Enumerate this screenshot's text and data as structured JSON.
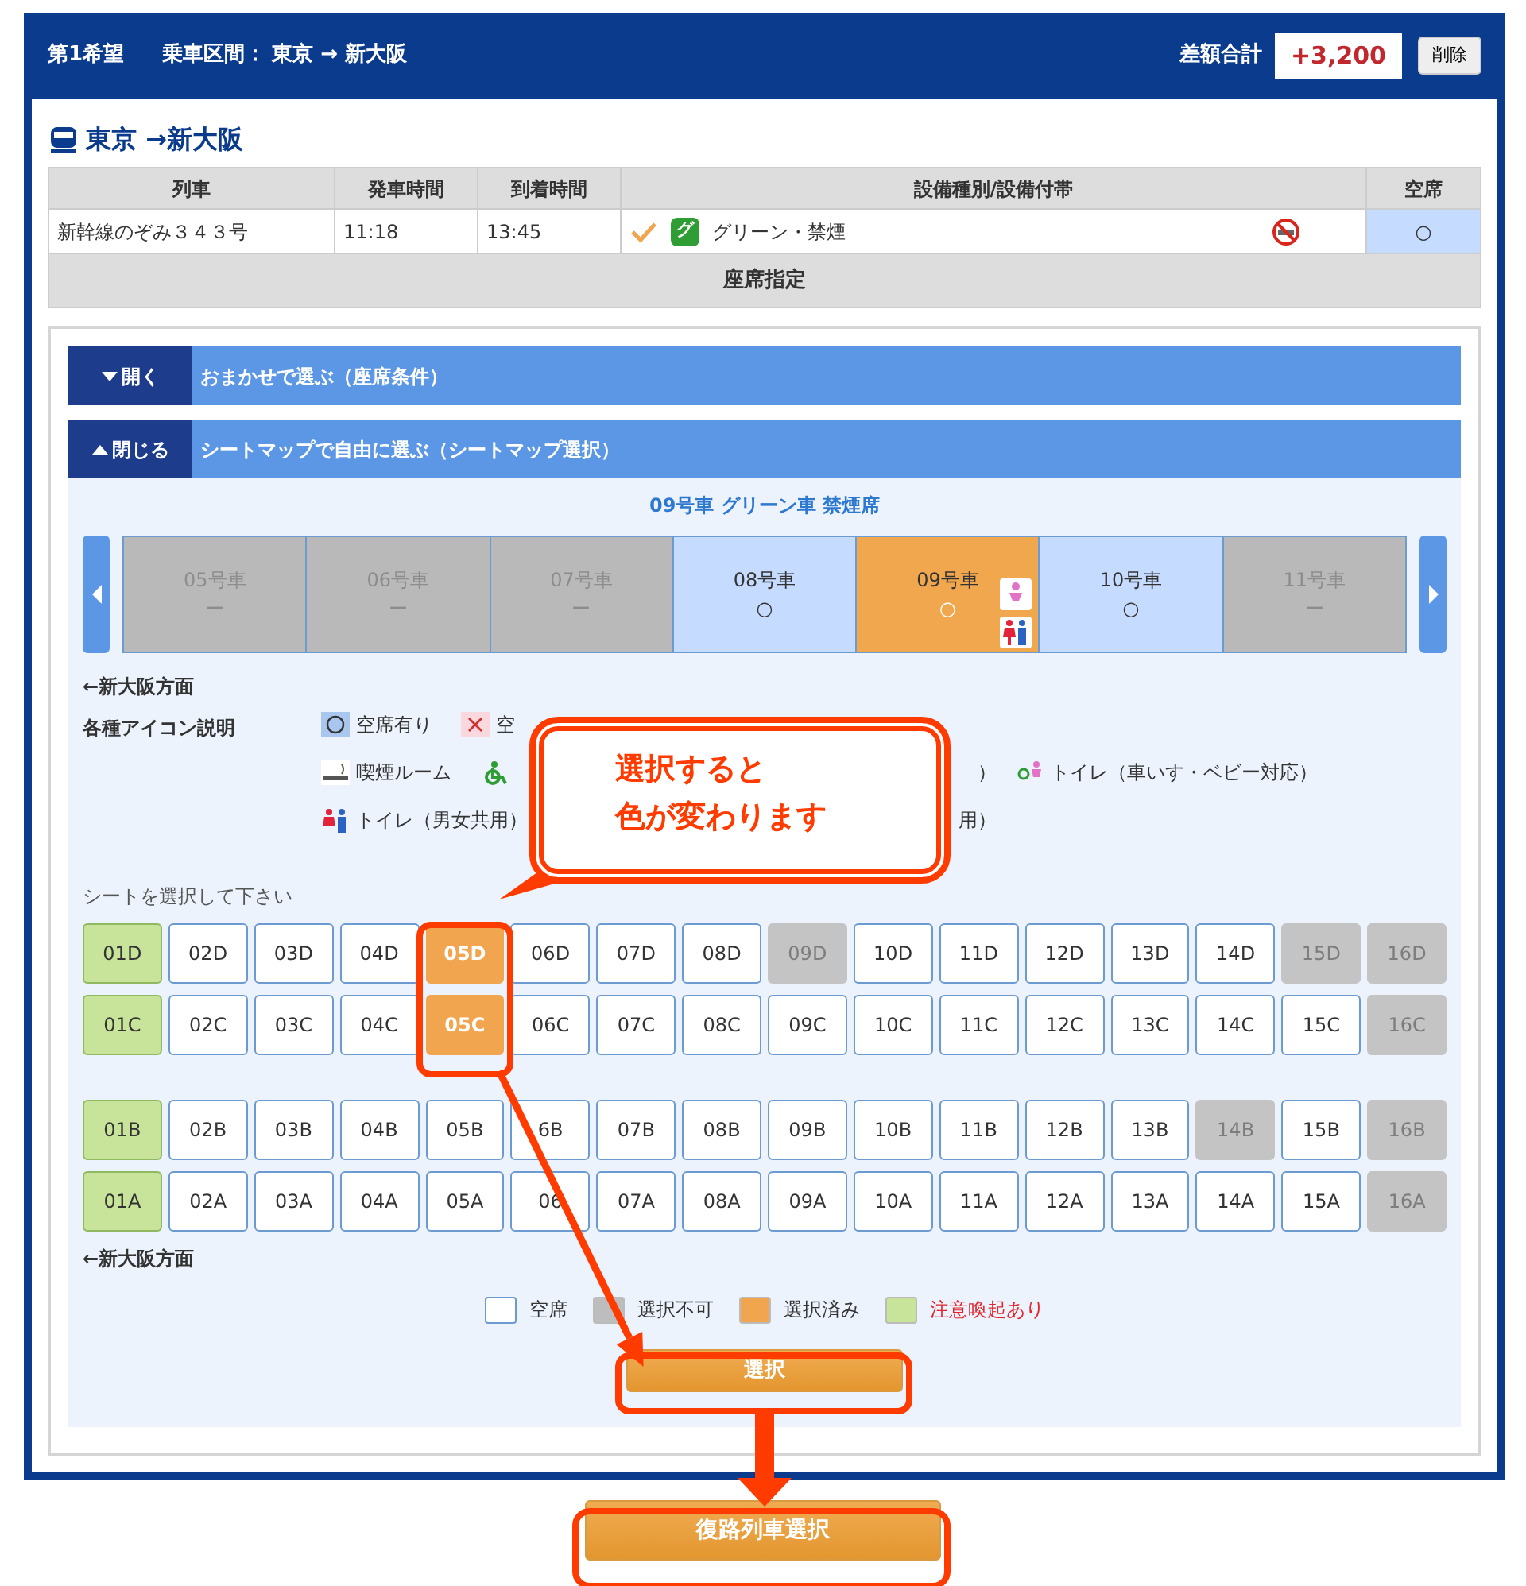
{
  "header": {
    "priority": "第1希望",
    "route_label": "乗車区間：",
    "route": "東京 → 新大阪",
    "total_label": "差額合計",
    "total": "+3,200",
    "delete_button": "削除"
  },
  "title": "東京 →新大阪",
  "train_table": {
    "columns": [
      "列車",
      "発車時間",
      "到着時間",
      "設備種別/設備付帯",
      "空席"
    ],
    "rows": [
      {
        "train": "新幹線のぞみ３４３号",
        "departure": "11:18",
        "arrival": "13:45",
        "checked": true,
        "car_badge": "グ",
        "facility": "グリーン・禁煙",
        "non_smoking": true,
        "vacancy": "○"
      }
    ],
    "footer": "座席指定"
  },
  "accordions": [
    {
      "toggle": "開く",
      "expanded": false,
      "title": "おまかせで選ぶ（座席条件）"
    },
    {
      "toggle": "閉じる",
      "expanded": true,
      "title": "シートマップで自由に選ぶ（シートマップ選択）"
    }
  ],
  "car_title": "09号車 グリーン車 禁煙席",
  "cars": [
    {
      "label": "05号車",
      "mark": "ー",
      "available": false,
      "selected": false,
      "toilets": false
    },
    {
      "label": "06号車",
      "mark": "ー",
      "available": false,
      "selected": false,
      "toilets": false
    },
    {
      "label": "07号車",
      "mark": "ー",
      "available": false,
      "selected": false,
      "toilets": false
    },
    {
      "label": "08号車",
      "mark": "○",
      "available": true,
      "selected": false,
      "toilets": false
    },
    {
      "label": "09号車",
      "mark": "○",
      "available": true,
      "selected": true,
      "toilets": true
    },
    {
      "label": "10号車",
      "mark": "○",
      "available": true,
      "selected": false,
      "toilets": false
    },
    {
      "label": "11号車",
      "mark": "ー",
      "available": false,
      "selected": false,
      "toilets": false
    }
  ],
  "direction_top": "←新大阪方面",
  "icon_legend_label": "各種アイコン説明",
  "icon_legend": [
    [
      {
        "kind": "vacant",
        "label": "空席有り"
      },
      {
        "kind": "full",
        "label": "空"
      }
    ],
    [
      {
        "kind": "smoking",
        "label": "喫煙ルーム"
      },
      {
        "kind": "wheelchair"
      },
      {
        "kind": "fragment",
        "label": "）"
      },
      {
        "kind": "baby-toilet",
        "label": "トイレ（車いす・ベビー対応）"
      }
    ],
    [
      {
        "kind": "toilet",
        "label": "トイレ（男女共用）"
      },
      {
        "kind": "fragment",
        "label": "用）"
      }
    ]
  ],
  "seat_prompt": "シートを選択して下さい",
  "seat_blocks": [
    [
      [
        {
          "label": "01D",
          "disabled": false,
          "selected": false,
          "caution": true
        },
        {
          "label": "02D",
          "disabled": false,
          "selected": false,
          "caution": false
        },
        {
          "label": "03D",
          "disabled": false,
          "selected": false,
          "caution": false
        },
        {
          "label": "04D",
          "disabled": false,
          "selected": false,
          "caution": false
        },
        {
          "label": "05D",
          "disabled": false,
          "selected": true,
          "caution": false
        },
        {
          "label": "06D",
          "disabled": false,
          "selected": false,
          "caution": false
        },
        {
          "label": "07D",
          "disabled": false,
          "selected": false,
          "caution": false
        },
        {
          "label": "08D",
          "disabled": false,
          "selected": false,
          "caution": false
        },
        {
          "label": "09D",
          "disabled": true,
          "selected": false,
          "caution": false
        },
        {
          "label": "10D",
          "disabled": false,
          "selected": false,
          "caution": false
        },
        {
          "label": "11D",
          "disabled": false,
          "selected": false,
          "caution": false
        },
        {
          "label": "12D",
          "disabled": false,
          "selected": false,
          "caution": false
        },
        {
          "label": "13D",
          "disabled": false,
          "selected": false,
          "caution": false
        },
        {
          "label": "14D",
          "disabled": false,
          "selected": false,
          "caution": false
        },
        {
          "label": "15D",
          "disabled": true,
          "selected": false,
          "caution": false
        },
        {
          "label": "16D",
          "disabled": true,
          "selected": false,
          "caution": false
        }
      ],
      [
        {
          "label": "01C",
          "disabled": false,
          "selected": false,
          "caution": true
        },
        {
          "label": "02C",
          "disabled": false,
          "selected": false,
          "caution": false
        },
        {
          "label": "03C",
          "disabled": false,
          "selected": false,
          "caution": false
        },
        {
          "label": "04C",
          "disabled": false,
          "selected": false,
          "caution": false
        },
        {
          "label": "05C",
          "disabled": false,
          "selected": true,
          "caution": false
        },
        {
          "label": "06C",
          "disabled": false,
          "selected": false,
          "caution": false
        },
        {
          "label": "07C",
          "disabled": false,
          "selected": false,
          "caution": false
        },
        {
          "label": "08C",
          "disabled": false,
          "selected": false,
          "caution": false
        },
        {
          "label": "09C",
          "disabled": false,
          "selected": false,
          "caution": false
        },
        {
          "label": "10C",
          "disabled": false,
          "selected": false,
          "caution": false
        },
        {
          "label": "11C",
          "disabled": false,
          "selected": false,
          "caution": false
        },
        {
          "label": "12C",
          "disabled": false,
          "selected": false,
          "caution": false
        },
        {
          "label": "13C",
          "disabled": false,
          "selected": false,
          "caution": false
        },
        {
          "label": "14C",
          "disabled": false,
          "selected": false,
          "caution": false
        },
        {
          "label": "15C",
          "disabled": false,
          "selected": false,
          "caution": false
        },
        {
          "label": "16C",
          "disabled": true,
          "selected": false,
          "caution": false
        }
      ]
    ],
    [
      [
        {
          "label": "01B",
          "disabled": false,
          "selected": false,
          "caution": true
        },
        {
          "label": "02B",
          "disabled": false,
          "selected": false,
          "caution": false
        },
        {
          "label": "03B",
          "disabled": false,
          "selected": false,
          "caution": false
        },
        {
          "label": "04B",
          "disabled": false,
          "selected": false,
          "caution": false
        },
        {
          "label": "05B",
          "disabled": false,
          "selected": false,
          "caution": false
        },
        {
          "label": "6B",
          "disabled": false,
          "selected": false,
          "caution": false
        },
        {
          "label": "07B",
          "disabled": false,
          "selected": false,
          "caution": false
        },
        {
          "label": "08B",
          "disabled": false,
          "selected": false,
          "caution": false
        },
        {
          "label": "09B",
          "disabled": false,
          "selected": false,
          "caution": false
        },
        {
          "label": "10B",
          "disabled": false,
          "selected": false,
          "caution": false
        },
        {
          "label": "11B",
          "disabled": false,
          "selected": false,
          "caution": false
        },
        {
          "label": "12B",
          "disabled": false,
          "selected": false,
          "caution": false
        },
        {
          "label": "13B",
          "disabled": false,
          "selected": false,
          "caution": false
        },
        {
          "label": "14B",
          "disabled": true,
          "selected": false,
          "caution": false
        },
        {
          "label": "15B",
          "disabled": false,
          "selected": false,
          "caution": false
        },
        {
          "label": "16B",
          "disabled": true,
          "selected": false,
          "caution": false
        }
      ],
      [
        {
          "label": "01A",
          "disabled": false,
          "selected": false,
          "caution": true
        },
        {
          "label": "02A",
          "disabled": false,
          "selected": false,
          "caution": false
        },
        {
          "label": "03A",
          "disabled": false,
          "selected": false,
          "caution": false
        },
        {
          "label": "04A",
          "disabled": false,
          "selected": false,
          "caution": false
        },
        {
          "label": "05A",
          "disabled": false,
          "selected": false,
          "caution": false
        },
        {
          "label": "06",
          "disabled": false,
          "selected": false,
          "caution": false
        },
        {
          "label": "07A",
          "disabled": false,
          "selected": false,
          "caution": false
        },
        {
          "label": "08A",
          "disabled": false,
          "selected": false,
          "caution": false
        },
        {
          "label": "09A",
          "disabled": false,
          "selected": false,
          "caution": false
        },
        {
          "label": "10A",
          "disabled": false,
          "selected": false,
          "caution": false
        },
        {
          "label": "11A",
          "disabled": false,
          "selected": false,
          "caution": false
        },
        {
          "label": "12A",
          "disabled": false,
          "selected": false,
          "caution": false
        },
        {
          "label": "13A",
          "disabled": false,
          "selected": false,
          "caution": false
        },
        {
          "label": "14A",
          "disabled": false,
          "selected": false,
          "caution": false
        },
        {
          "label": "15A",
          "disabled": false,
          "selected": false,
          "caution": false
        },
        {
          "label": "16A",
          "disabled": true,
          "selected": false,
          "caution": false
        }
      ]
    ]
  ],
  "direction_bottom": "←新大阪方面",
  "seat_legend": [
    {
      "label": "空席",
      "color": "#ffffff",
      "warning": false
    },
    {
      "label": "選択不可",
      "color": "#bdbdbd",
      "warning": false
    },
    {
      "label": "選択済み",
      "color": "#f0a54e",
      "warning": false
    },
    {
      "label": "注意喚起あり",
      "color": "#c8e39a",
      "warning": true
    }
  ],
  "select_button": "選択",
  "return_button": "復路列車選択",
  "callout": [
    "選択すると",
    "色が変わります"
  ]
}
